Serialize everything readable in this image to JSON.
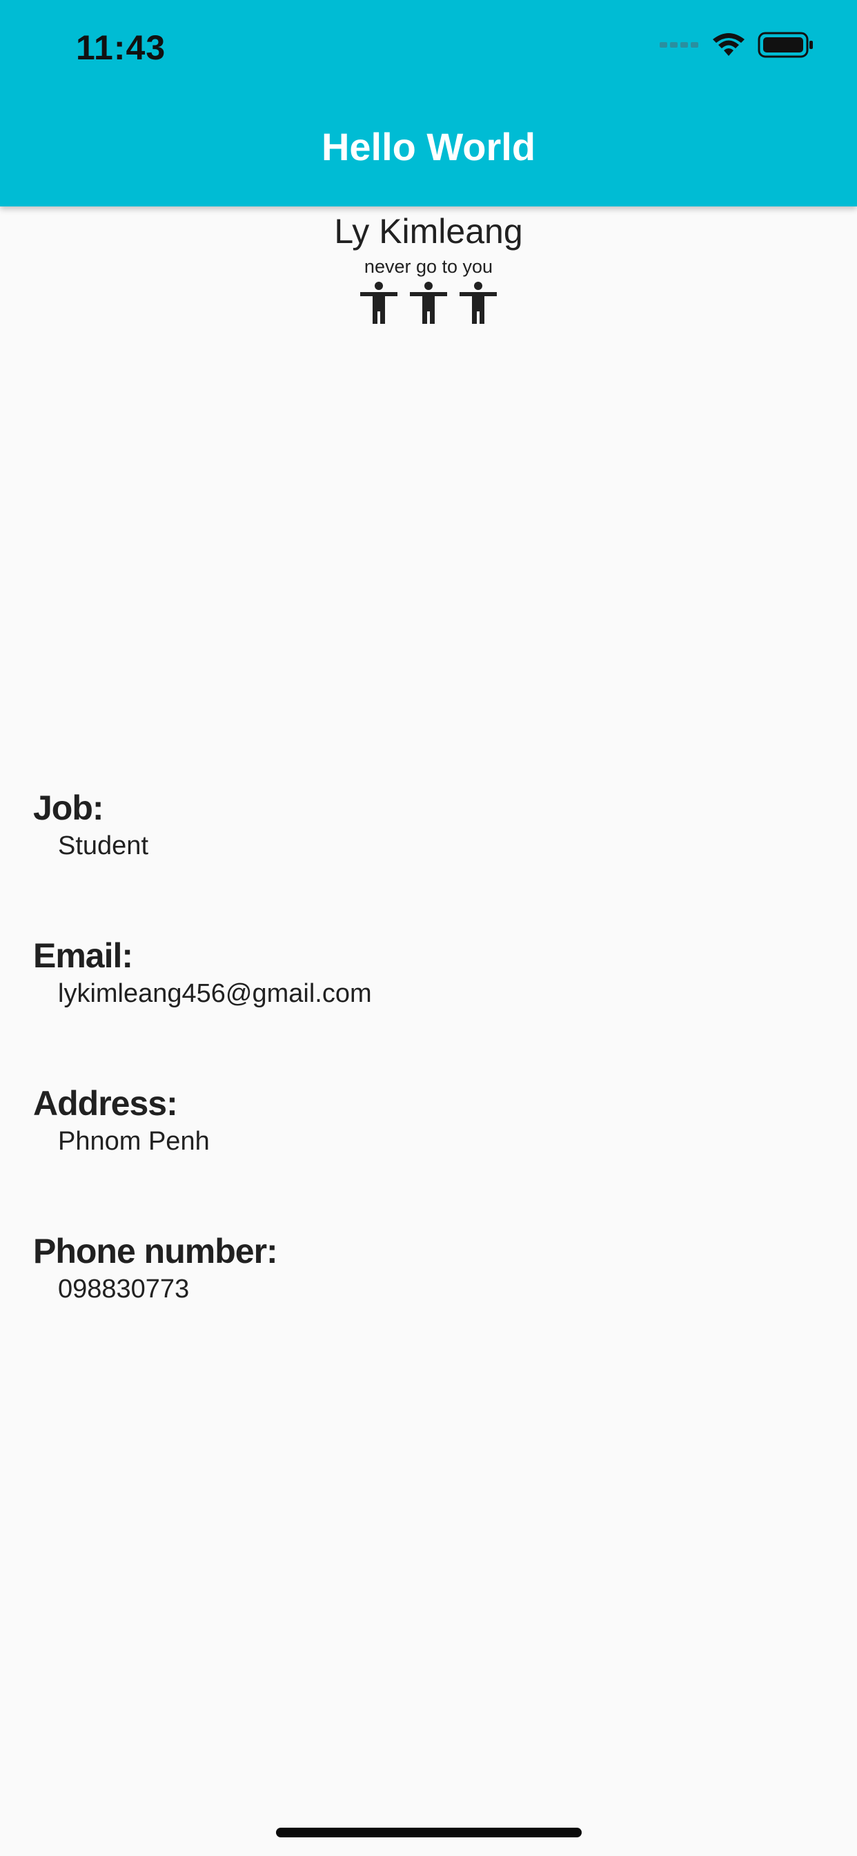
{
  "status_bar": {
    "time": "11:43",
    "icons": [
      "signal-icon",
      "wifi-icon",
      "battery-icon"
    ]
  },
  "app_bar": {
    "title": "Hello World",
    "color": "#00bcd4"
  },
  "profile": {
    "name": "Ly Kimleang",
    "tagline": "never go to you",
    "figure_icon": "accessibility-icon",
    "figure_count": 3
  },
  "fields": [
    {
      "label": "Job:",
      "value": "Student"
    },
    {
      "label": "Email:",
      "value": "lykimleang456@gmail.com"
    },
    {
      "label": "Address:",
      "value": "Phnom Penh"
    },
    {
      "label": "Phone number:",
      "value": "098830773"
    }
  ]
}
